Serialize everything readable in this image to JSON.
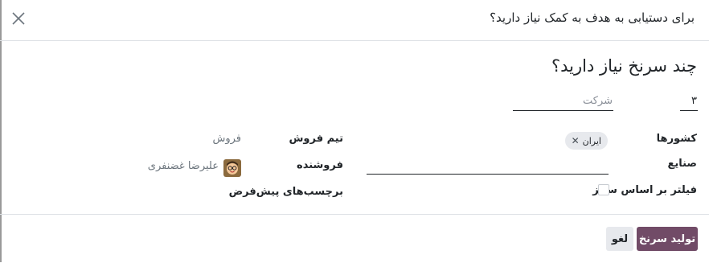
{
  "dialog": {
    "title": "برای دستیابی به هدف به کمک نیاز دارید؟",
    "close_icon": "close-icon"
  },
  "form": {
    "heading": "چند سرنخ نیاز دارید؟",
    "lead_count": "۳",
    "target_placeholder": "شرکت",
    "countries_label": "کشورها",
    "country_tag": "ایران",
    "industries_label": "صنایع",
    "size_filter_label": "فیلتر بر اساس سایز",
    "sales_team_label": "تیم فروش",
    "sales_team_value": "فروش",
    "salesperson_label": "فروشنده",
    "salesperson_value": "علیرضا غضنفری",
    "default_tags_label": "برچسب‌های پیش‌فرض"
  },
  "footer": {
    "generate_label": "تولید سرنخ",
    "cancel_label": "لغو"
  },
  "colors": {
    "primary": "#714b67",
    "tag_bg": "#e7e9ed"
  }
}
